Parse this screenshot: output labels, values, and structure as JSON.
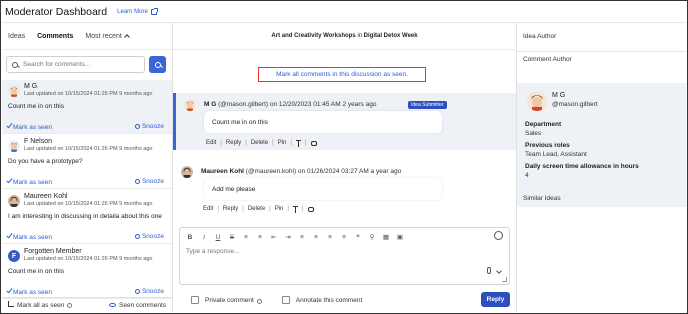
{
  "header": {
    "title": "Moderator Dashboard",
    "learn_more": "Learn More"
  },
  "left": {
    "tabs": [
      {
        "label": "Ideas"
      },
      {
        "label": "Comments"
      },
      {
        "label": "Most recent"
      }
    ],
    "search_placeholder": "Search for comments...",
    "comments": [
      {
        "name": "M G",
        "updated": "Last updated on 10/15/2024 01:26 PM 9 months ago",
        "text": "Count me in on this",
        "mark": "Mark as seen",
        "snooze": "Snooze",
        "avatar": "cartoon-avatar"
      },
      {
        "name": "F Nelson",
        "updated": "Last updated on 10/15/2024 01:26 PM 9 months ago",
        "text": "Do you have a prototype?",
        "mark": "Mark as seen",
        "snooze": "Snooze",
        "avatar": "cartoon-avatar"
      },
      {
        "name": "Maureen Kohl",
        "updated": "Last updated on 10/15/2024 01:26 PM 9 months ago",
        "text": "I am interesting in discussing in detaila about this one",
        "mark": "Mark as seen",
        "snooze": "Snooze",
        "avatar": "photo-avatar"
      },
      {
        "name": "Forgotten Member",
        "updated": "Last updated on 10/15/2024 01:26 PM 9 months ago",
        "text": "Count me in on this",
        "mark": "Mark as seen",
        "snooze": "Snooze",
        "avatar": "letter-avatar",
        "initial": "F"
      }
    ],
    "footer": {
      "mark_all": "Mark all as seen",
      "seen_comments": "Seen comments"
    }
  },
  "middle": {
    "title_prefix": "Art and Creativity Workshops",
    "title_in": " in ",
    "title_suffix": "Digital Detox Week",
    "mark_all_link": "Mark all comments in this discussion as seen.",
    "comments": [
      {
        "name": "M G",
        "meta": "(@mason.gilbert) on 12/20/2023 01:45 AM 2 years ago",
        "badge": "Idea Submitter",
        "text": "Count me in on this"
      },
      {
        "name": "Maureen Kohl",
        "meta": "(@maureen.kohl) on 01/26/2024 03:27 AM a year ago",
        "text": "Add me please"
      }
    ],
    "actions": {
      "edit": "Edit",
      "reply": "Reply",
      "delete": "Delete",
      "pin": "Pin"
    },
    "editor": {
      "placeholder": "Type a response...",
      "toolbar": [
        "B",
        "I",
        "U",
        "S",
        "≡",
        "≡",
        "⇤",
        "⇥",
        "≡",
        "≡",
        "≡",
        "≡",
        "❝",
        "⚲",
        "▦",
        "▣"
      ]
    },
    "private_comment": "Private comment",
    "annotate": "Annotate this comment",
    "reply_button": "Reply"
  },
  "right": {
    "idea_author": "Idea Author",
    "comment_author": "Comment Author",
    "author_name": "M G",
    "author_handle": "@mason.gilbert",
    "department_label": "Department",
    "department_value": "Sales",
    "roles_label": "Previous roles",
    "roles_value": "Team Lead, Assistant",
    "screen_label": "Daily screen time allowance in hours",
    "screen_value": "4",
    "similar_ideas": "Similar Ideas"
  }
}
